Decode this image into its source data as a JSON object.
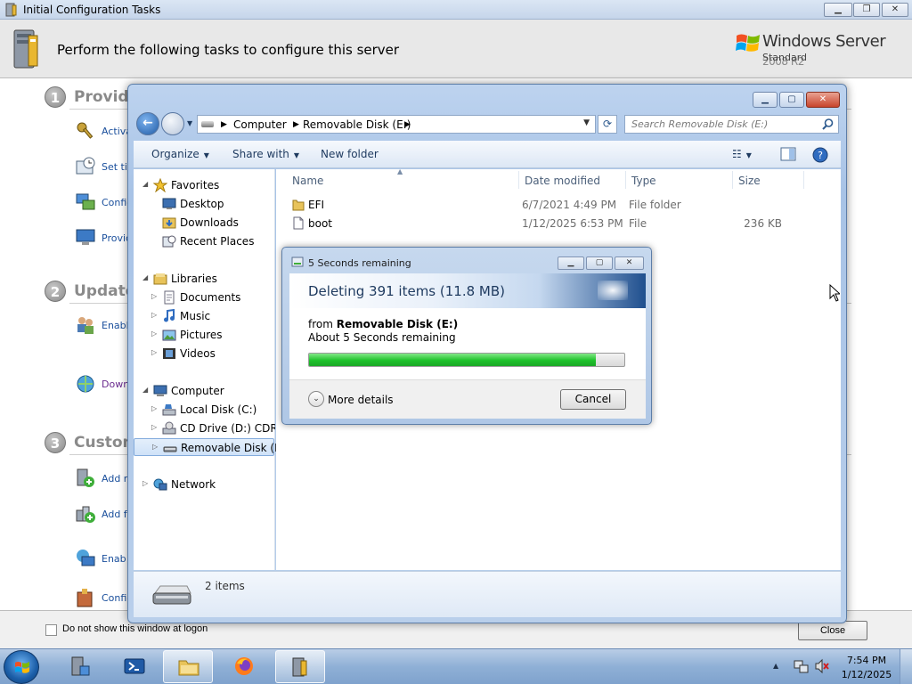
{
  "ict": {
    "window_title": "Initial Configuration Tasks",
    "header_text": "Perform the following tasks to configure this server",
    "brand": {
      "name": "Windows Server",
      "version": "2008 R2",
      "edition": "Standard"
    },
    "sections": [
      {
        "num": "1",
        "title": "Provide"
      },
      {
        "num": "2",
        "title": "Update"
      },
      {
        "num": "3",
        "title": "Custom"
      }
    ],
    "tasks": [
      {
        "label": "Activa",
        "icon": "key-icon"
      },
      {
        "label": "Set tim",
        "icon": "clock-icon"
      },
      {
        "label": "Config",
        "icon": "network-icon"
      },
      {
        "label": "Provid",
        "icon": "computer-icon"
      },
      {
        "label": "Enable",
        "icon": "users-icon"
      },
      {
        "label": "Down",
        "icon": "download-globe-icon"
      },
      {
        "label": "Add ro",
        "icon": "add-roles-icon"
      },
      {
        "label": "Add fe",
        "icon": "add-features-icon"
      },
      {
        "label": "Enab",
        "icon": "remote-desktop-icon"
      },
      {
        "label": "Config",
        "icon": "firewall-icon"
      }
    ],
    "checkbox_label": "Do not show this window at logon",
    "close_label": "Close"
  },
  "explorer": {
    "breadcrumb": [
      "Computer",
      "Removable Disk (E:)"
    ],
    "search_placeholder": "Search Removable Disk (E:)",
    "toolbar": {
      "organize": "Organize",
      "share": "Share with",
      "new_folder": "New folder"
    },
    "nav": {
      "favorites": "Favorites",
      "fav_items": [
        "Desktop",
        "Downloads",
        "Recent Places"
      ],
      "libraries": "Libraries",
      "lib_items": [
        "Documents",
        "Music",
        "Pictures",
        "Videos"
      ],
      "computer": "Computer",
      "comp_items": [
        "Local Disk (C:)",
        "CD Drive (D:) CDROM",
        "Removable Disk (E:)"
      ],
      "network": "Network"
    },
    "columns": [
      "Name",
      "Date modified",
      "Type",
      "Size"
    ],
    "files": [
      {
        "name": "EFI",
        "date": "6/7/2021 4:49 PM",
        "type": "File folder",
        "size": "",
        "icon": "folder-icon"
      },
      {
        "name": "boot",
        "date": "1/12/2025 6:53 PM",
        "type": "File",
        "size": "236 KB",
        "icon": "file-icon"
      }
    ],
    "item_count": "2 items"
  },
  "progress_dialog": {
    "title": "5 Seconds remaining",
    "heading": "Deleting 391 items (11.8 MB)",
    "from_prefix": "from",
    "from_location": "Removable Disk (E:)",
    "remaining": "About 5 Seconds remaining",
    "progress": 0.91,
    "more_details": "More details",
    "cancel": "Cancel"
  },
  "taskbar": {
    "time": "7:54 PM",
    "date": "1/12/2025"
  },
  "colors": {
    "progress_green": "#1ec22b",
    "link_blue": "#1a4f9c",
    "title_gray": "#8a8a8a"
  }
}
